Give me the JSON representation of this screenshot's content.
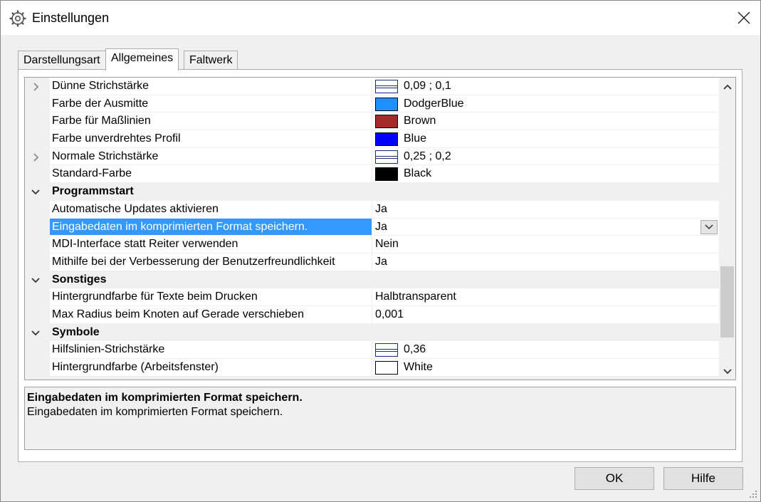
{
  "window": {
    "title": "Einstellungen",
    "icon": "gear-icon",
    "close_icon": "close-icon"
  },
  "tabs": [
    {
      "label": "Darstellungsart",
      "active": false
    },
    {
      "label": "Allgemeines",
      "active": true
    },
    {
      "label": "Faltwerk",
      "active": false
    }
  ],
  "grid": {
    "rows": [
      {
        "type": "prop",
        "expander": "chevron-right-icon",
        "name": "Dünne Strichstärke",
        "swatch": "lines",
        "value": "0,09 ; 0,1"
      },
      {
        "type": "prop",
        "name": "Farbe der Ausmitte",
        "swatch": "#1e90ff",
        "value": "DodgerBlue"
      },
      {
        "type": "prop",
        "name": "Farbe für Maßlinien",
        "swatch": "#a52a2a",
        "value": "Brown"
      },
      {
        "type": "prop",
        "name": "Farbe unverdrehtes Profil",
        "swatch": "#0000ff",
        "value": "Blue"
      },
      {
        "type": "prop",
        "expander": "chevron-right-icon",
        "name": "Normale Strichstärke",
        "swatch": "lines",
        "value": "0,25 ; 0,2"
      },
      {
        "type": "prop",
        "name": "Standard-Farbe",
        "swatch": "#000000",
        "value": "Black"
      },
      {
        "type": "category",
        "expander": "chevron-down-icon",
        "name": "Programmstart"
      },
      {
        "type": "prop",
        "name": "Automatische Updates aktivieren",
        "value": "Ja"
      },
      {
        "type": "prop",
        "name": "Eingabedaten im komprimierten Format speichern.",
        "value": "Ja",
        "selected": true,
        "dropdown": true
      },
      {
        "type": "prop",
        "name": "MDI-Interface statt Reiter verwenden",
        "value": "Nein"
      },
      {
        "type": "prop",
        "name": "Mithilfe bei der Verbesserung der Benutzerfreundlichkeit",
        "value": "Ja"
      },
      {
        "type": "category",
        "expander": "chevron-down-icon",
        "name": "Sonstiges"
      },
      {
        "type": "prop",
        "name": "Hintergrundfarbe für Texte beim Drucken",
        "value": "Halbtransparent"
      },
      {
        "type": "prop",
        "name": "Max Radius beim Knoten auf Gerade verschieben",
        "value": "0,001"
      },
      {
        "type": "category",
        "expander": "chevron-down-icon",
        "name": "Symbole"
      },
      {
        "type": "prop",
        "name": "Hilfslinien-Strichstärke",
        "swatch": "lines",
        "value": "0,36"
      },
      {
        "type": "prop",
        "name": "Hintergrundfarbe (Arbeitsfenster)",
        "swatch": "#ffffff",
        "value": "White"
      }
    ],
    "scroll_position_fraction": 0.62
  },
  "description": {
    "title": "Eingabedaten im komprimierten Format speichern.",
    "body": "Eingabedaten im komprimierten Format speichern."
  },
  "buttons": {
    "ok": "OK",
    "help": "Hilfe"
  },
  "colors": {
    "selection": "#3399ff",
    "window_bg": "#f0f0f0"
  }
}
